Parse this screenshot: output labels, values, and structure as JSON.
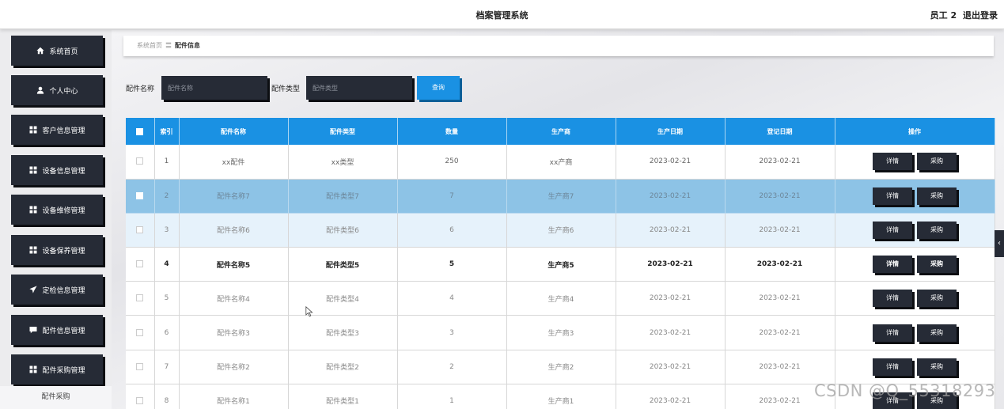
{
  "header": {
    "app_title": "档案管理系统",
    "user_name": "员工 2",
    "logout_label": "退出登录"
  },
  "sidebar": {
    "items": [
      {
        "label": "系统首页",
        "icon": "home-icon"
      },
      {
        "label": "个人中心",
        "icon": "user-icon"
      },
      {
        "label": "客户信息管理",
        "icon": "grid-icon"
      },
      {
        "label": "设备信息管理",
        "icon": "grid-icon"
      },
      {
        "label": "设备维修管理",
        "icon": "grid-icon"
      },
      {
        "label": "设备保养管理",
        "icon": "grid-icon"
      },
      {
        "label": "定检信息管理",
        "icon": "send-icon"
      },
      {
        "label": "配件信息管理",
        "icon": "message-icon"
      },
      {
        "label": "配件采购管理",
        "icon": "grid-icon"
      }
    ],
    "sub_item": "配件采购"
  },
  "breadcrumb": {
    "home": "系统首页",
    "separator": "〓",
    "current": "配件信息"
  },
  "search": {
    "name_label": "配件名称",
    "name_placeholder": "配件名称",
    "type_label": "配件类型",
    "type_placeholder": "配件类型",
    "query_label": "查询"
  },
  "table": {
    "columns": [
      "索引",
      "配件名称",
      "配件类型",
      "数量",
      "生产商",
      "生产日期",
      "登记日期",
      "操作"
    ],
    "rows": [
      {
        "index": "1",
        "name": "xx配件",
        "type": "xx类型",
        "qty": "250",
        "maker": "xx产商",
        "produce_date": "2023-02-21",
        "register_date": "2023-02-21"
      },
      {
        "index": "2",
        "name": "配件名称7",
        "type": "配件类型7",
        "qty": "7",
        "maker": "生产商7",
        "produce_date": "2023-02-21",
        "register_date": "2023-02-21"
      },
      {
        "index": "3",
        "name": "配件名称6",
        "type": "配件类型6",
        "qty": "6",
        "maker": "生产商6",
        "produce_date": "2023-02-21",
        "register_date": "2023-02-21"
      },
      {
        "index": "4",
        "name": "配件名称5",
        "type": "配件类型5",
        "qty": "5",
        "maker": "生产商5",
        "produce_date": "2023-02-21",
        "register_date": "2023-02-21"
      },
      {
        "index": "5",
        "name": "配件名称4",
        "type": "配件类型4",
        "qty": "4",
        "maker": "生产商4",
        "produce_date": "2023-02-21",
        "register_date": "2023-02-21"
      },
      {
        "index": "6",
        "name": "配件名称3",
        "type": "配件类型3",
        "qty": "3",
        "maker": "生产商3",
        "produce_date": "2023-02-21",
        "register_date": "2023-02-21"
      },
      {
        "index": "7",
        "name": "配件名称2",
        "type": "配件类型2",
        "qty": "2",
        "maker": "生产商2",
        "produce_date": "2023-02-21",
        "register_date": "2023-02-21"
      },
      {
        "index": "8",
        "name": "配件名称1",
        "type": "配件类型1",
        "qty": "1",
        "maker": "生产商1",
        "produce_date": "2023-02-21",
        "register_date": "2023-02-21"
      }
    ],
    "detail_label": "详情",
    "purchase_label": "采购"
  },
  "side_toggle": "‹",
  "watermark": "CSDN @Q_55318293",
  "colors": {
    "accent": "#1a91e3",
    "dark_button": "#262b36",
    "selected_row": "#8dc3e6"
  }
}
